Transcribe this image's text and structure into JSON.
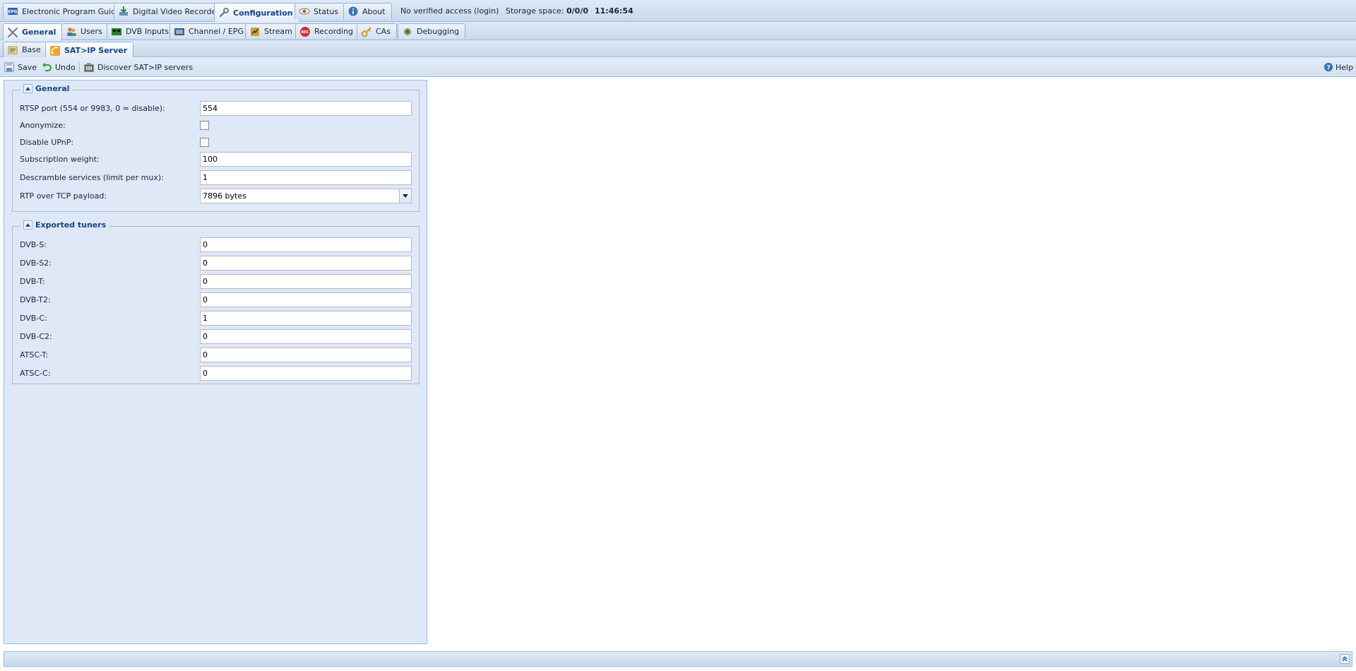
{
  "top_tabs": [
    {
      "label": "Electronic Program Guide",
      "icon": "epg-icon"
    },
    {
      "label": "Digital Video Recorder",
      "icon": "dvr-download-icon"
    },
    {
      "label": "Configuration",
      "icon": "wrench-icon",
      "active": true
    },
    {
      "label": "Status",
      "icon": "eye-icon"
    },
    {
      "label": "About",
      "icon": "info-icon"
    }
  ],
  "status": {
    "access": "No verified access",
    "login": "(login)",
    "storage_label": "Storage space:",
    "storage_value": "0/0/0",
    "time": "11:46:54"
  },
  "config_tabs": [
    {
      "label": "General",
      "icon": "tools-icon",
      "active": true
    },
    {
      "label": "Users",
      "icon": "users-icon"
    },
    {
      "label": "DVB Inputs",
      "icon": "dvb-card-icon"
    },
    {
      "label": "Channel / EPG",
      "icon": "tv-icon"
    },
    {
      "label": "Stream",
      "icon": "stream-icon"
    },
    {
      "label": "Recording",
      "icon": "rec-icon"
    },
    {
      "label": "CAs",
      "icon": "key-icon"
    },
    {
      "label": "Debugging",
      "icon": "bug-icon"
    }
  ],
  "sub_tabs": [
    {
      "label": "Base",
      "icon": "base-icon"
    },
    {
      "label": "SAT>IP Server",
      "icon": "satip-icon",
      "active": true
    }
  ],
  "toolbar": {
    "save": "Save",
    "undo": "Undo",
    "discover": "Discover SAT>IP servers",
    "help": "Help"
  },
  "general": {
    "legend": "General",
    "rtsp_port_label": "RTSP port (554 or 9983, 0 = disable):",
    "rtsp_port_value": "554",
    "anonymize_label": "Anonymize:",
    "anonymize_checked": false,
    "disable_upnp_label": "Disable UPnP:",
    "disable_upnp_checked": false,
    "weight_label": "Subscription weight:",
    "weight_value": "100",
    "descramble_label": "Descramble services (limit per mux):",
    "descramble_value": "1",
    "rtp_tcp_label": "RTP over TCP payload:",
    "rtp_tcp_value": "7896 bytes"
  },
  "tuners": {
    "legend": "Exported tuners",
    "rows": [
      {
        "label": "DVB-S:",
        "value": "0"
      },
      {
        "label": "DVB-S2:",
        "value": "0"
      },
      {
        "label": "DVB-T:",
        "value": "0"
      },
      {
        "label": "DVB-T2:",
        "value": "0"
      },
      {
        "label": "DVB-C:",
        "value": "1"
      },
      {
        "label": "DVB-C2:",
        "value": "0"
      },
      {
        "label": "ATSC-T:",
        "value": "0"
      },
      {
        "label": "ATSC-C:",
        "value": "0"
      }
    ]
  },
  "colors": {
    "header_bg": "#d0def0",
    "panel_bg": "#dfe8f6",
    "accent": "#15428b",
    "border": "#99bbe8"
  }
}
